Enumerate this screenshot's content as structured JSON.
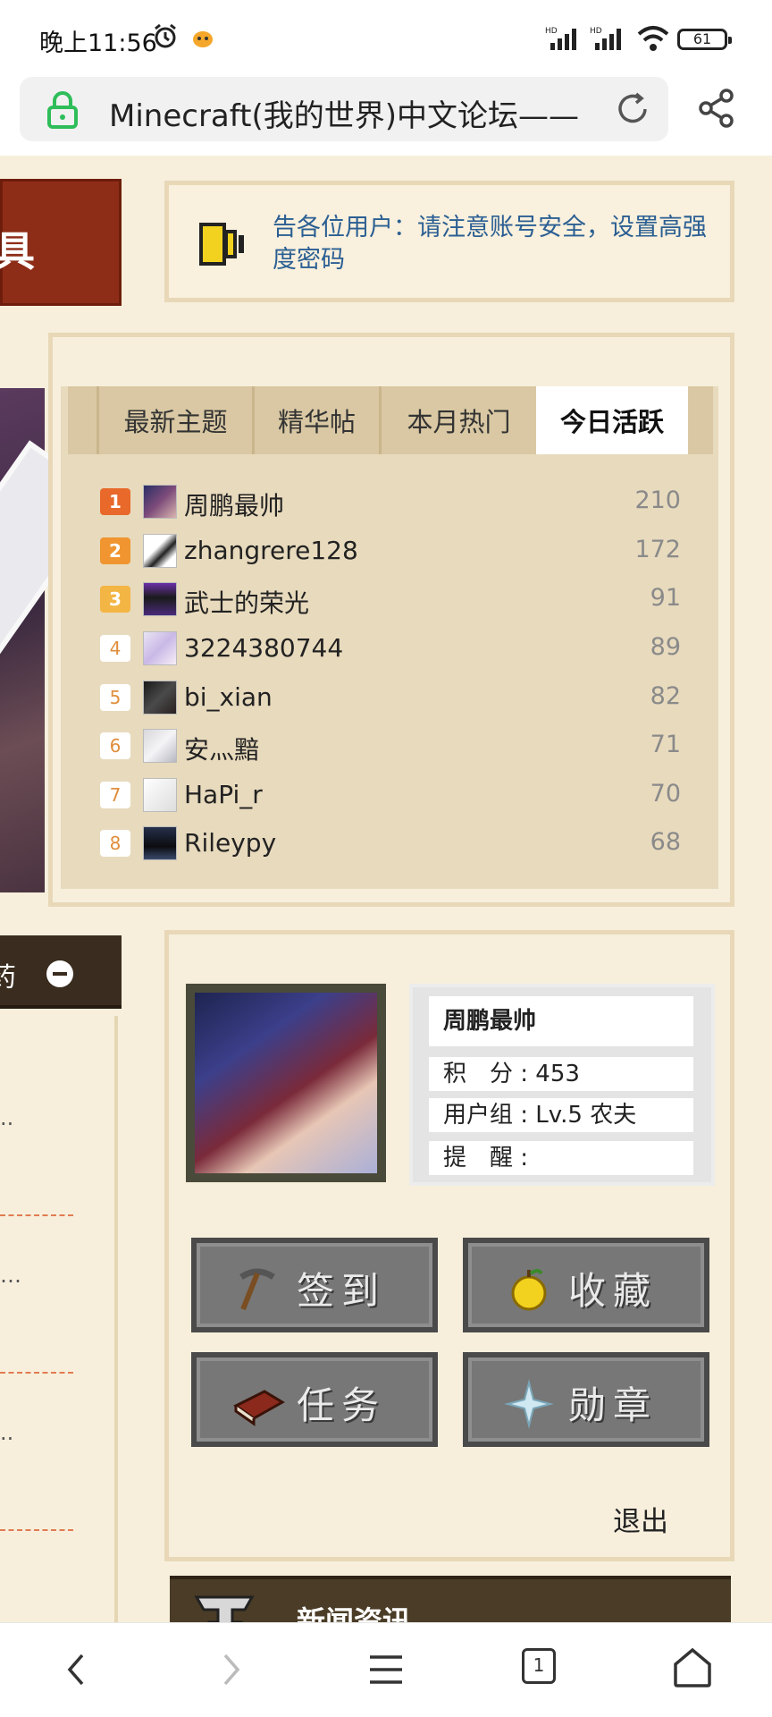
{
  "status_bar": {
    "time": "晚上11:56",
    "battery": "61",
    "network_label": "HD"
  },
  "browser": {
    "url_title": "Minecraft(我的世界)中文论坛——"
  },
  "left_partial": {
    "banner_char": "具",
    "section_char": "药"
  },
  "notice": {
    "text": "告各位用户：请注意账号安全，设置高强度密码"
  },
  "tabs": [
    {
      "label": "最新主题",
      "active": false
    },
    {
      "label": "精华帖",
      "active": false
    },
    {
      "label": "本月热门",
      "active": false
    },
    {
      "label": "今日活跃",
      "active": true
    }
  ],
  "active_users": [
    {
      "rank": "1",
      "name": "周鹏最帅",
      "score": "210"
    },
    {
      "rank": "2",
      "name": "zhangrere128",
      "score": "172"
    },
    {
      "rank": "3",
      "name": "武士的荣光",
      "score": "91"
    },
    {
      "rank": "4",
      "name": "3224380744",
      "score": "89"
    },
    {
      "rank": "5",
      "name": "bi_xian",
      "score": "82"
    },
    {
      "rank": "6",
      "name": "安灬黯",
      "score": "71"
    },
    {
      "rank": "7",
      "name": "HaPi_r",
      "score": "70"
    },
    {
      "rank": "8",
      "name": "Rileypy",
      "score": "68"
    }
  ],
  "profile": {
    "username": "周鹏最帅",
    "points": "积　分 : 453",
    "group": "用户组 : Lv.5 农夫",
    "reminder": "提　醒 :"
  },
  "actions": {
    "sign_in": "签到",
    "favorites": "收藏",
    "tasks": "任务",
    "medals": "勋章",
    "logout": "退出"
  },
  "news": {
    "title": "新闻资讯"
  },
  "bottom_nav": {
    "tab_count": "1"
  },
  "colors": {
    "page_bg": "#f7efdc",
    "notice_text": "#2b5f93",
    "rank1": "#e8692a",
    "rank2": "#f0952f",
    "rank3": "#f3b544"
  }
}
